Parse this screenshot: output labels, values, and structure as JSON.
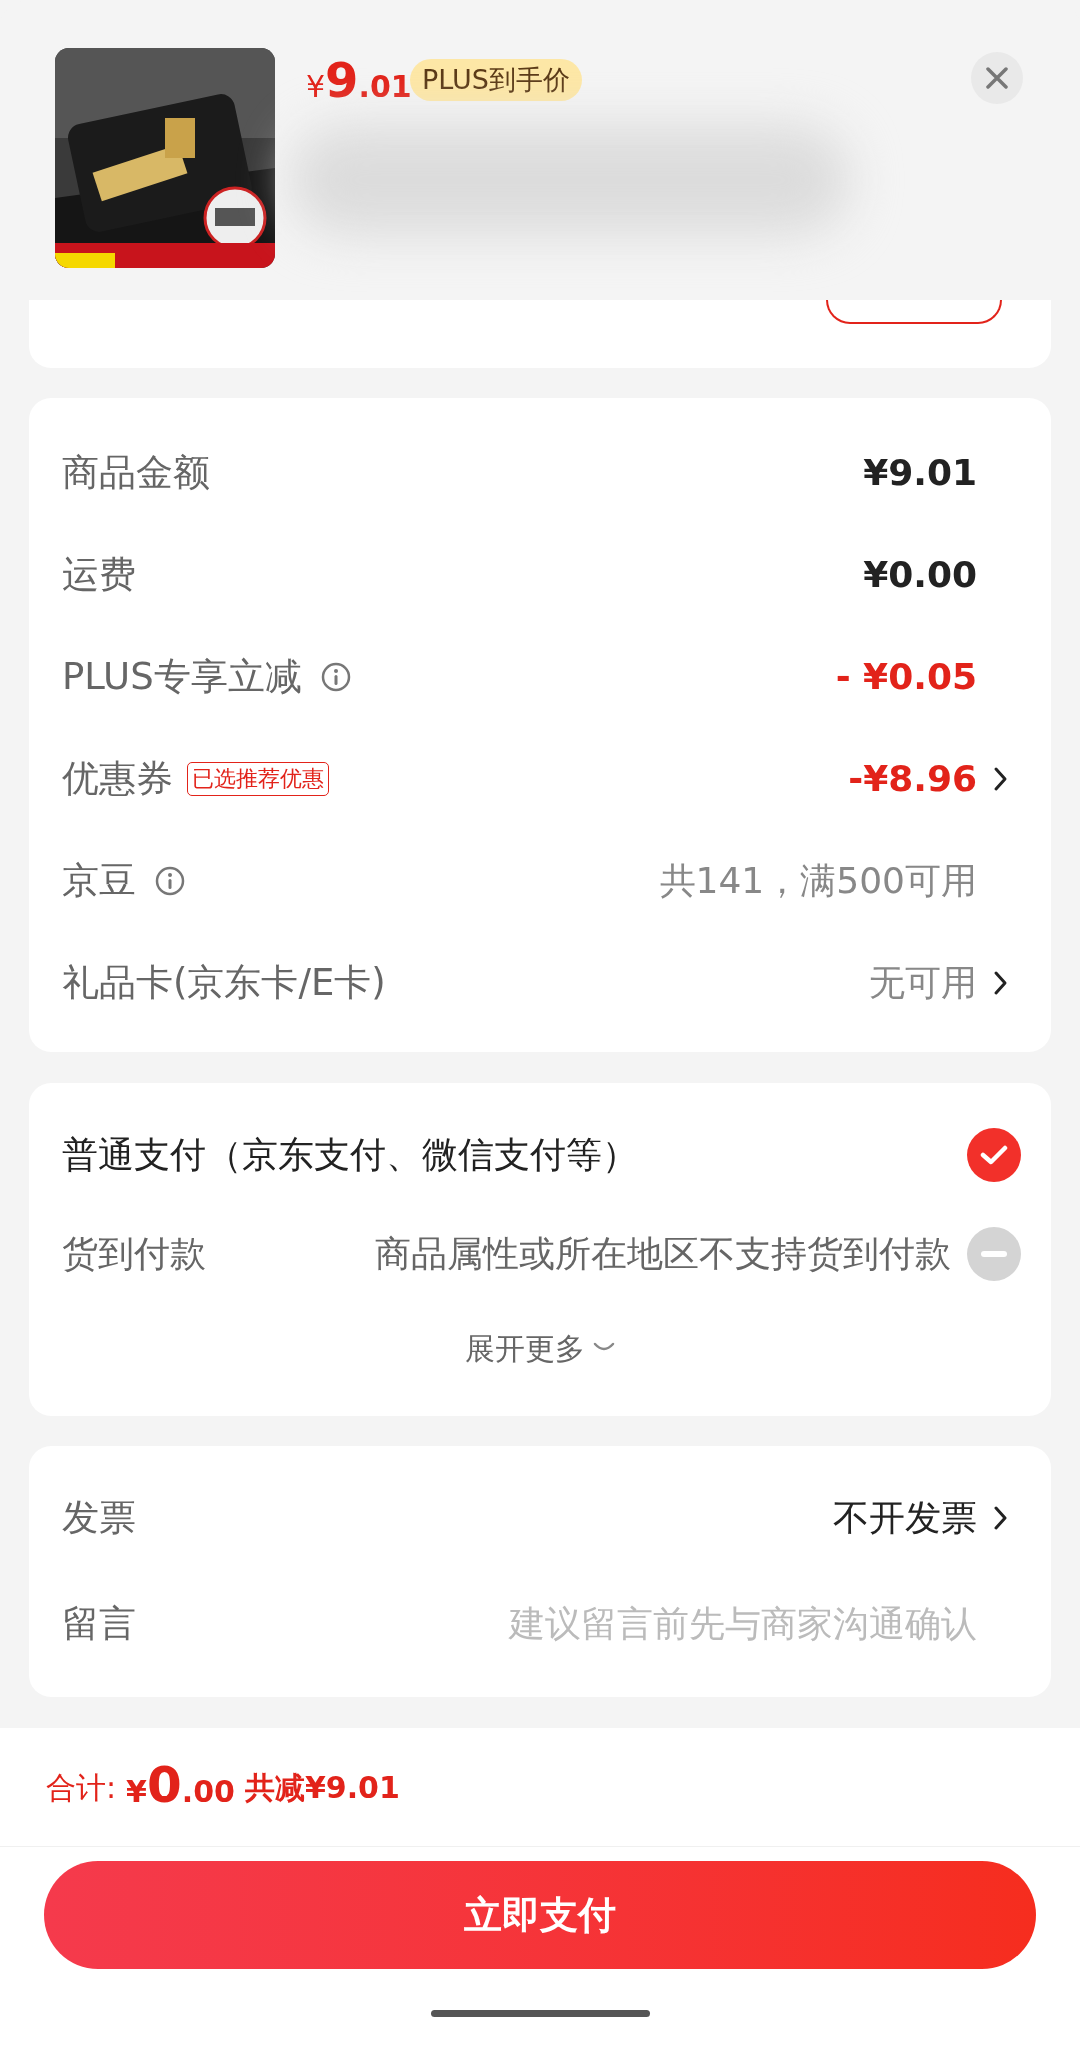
{
  "header": {
    "price_symbol": "¥",
    "price_integer": "9",
    "price_decimal": ".01",
    "price_tag": "PLUS到手价"
  },
  "summary": [
    {
      "label": "商品金额",
      "value": "¥9.01",
      "kind": "normal",
      "info": false,
      "chevron": false
    },
    {
      "label": "运费",
      "value": "¥0.00",
      "kind": "normal",
      "info": false,
      "chevron": false
    },
    {
      "label": "PLUS专享立减",
      "value": "- ¥0.05",
      "kind": "discount",
      "info": true,
      "chevron": false
    },
    {
      "label": "优惠券",
      "tag": "已选推荐优惠",
      "value": "-¥8.96",
      "kind": "discount",
      "info": false,
      "chevron": true
    },
    {
      "label": "京豆",
      "value": "共141，满500可用",
      "kind": "muted",
      "info": true,
      "chevron": false
    },
    {
      "label": "礼品卡(京东卡/E卡)",
      "value": "无可用",
      "kind": "muted",
      "info": false,
      "chevron": true
    }
  ],
  "payment_methods": [
    {
      "label": "普通支付（京东支付、微信支付等）",
      "selected": true,
      "available": true
    },
    {
      "label": "货到付款",
      "note": "商品属性或所在地区不支持货到付款",
      "selected": false,
      "available": false
    }
  ],
  "expand_more": "展开更多",
  "extras": [
    {
      "kind": "value",
      "label": "发票",
      "value": "不开发票",
      "chevron": true
    },
    {
      "kind": "input",
      "label": "留言",
      "placeholder": "建议留言前先与商家沟通确认"
    }
  ],
  "footer": {
    "total_label": "合计:",
    "total_symbol": "¥",
    "total_integer": "0",
    "total_decimal": ".00",
    "saved": "共减¥9.01",
    "pay_button": "立即支付"
  }
}
